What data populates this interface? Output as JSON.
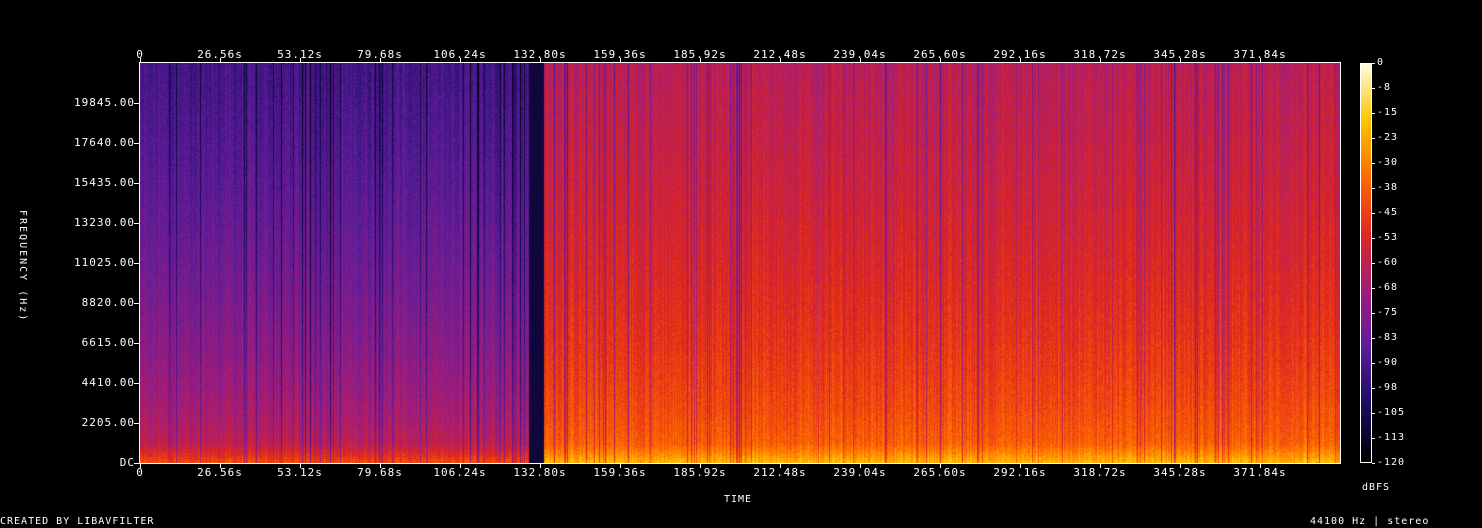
{
  "chart_data": {
    "type": "heatmap",
    "xlabel": "TIME",
    "ylabel": "FREQUENCY (Hz)",
    "x_ticks": [
      "0",
      "26.56s",
      "53.12s",
      "79.68s",
      "106.24s",
      "132.80s",
      "159.36s",
      "185.92s",
      "212.48s",
      "239.04s",
      "265.60s",
      "292.16s",
      "318.72s",
      "345.28s",
      "371.84s"
    ],
    "x_tick_values": [
      0,
      26.56,
      53.12,
      79.68,
      106.24,
      132.8,
      159.36,
      185.92,
      212.48,
      239.04,
      265.6,
      292.16,
      318.72,
      345.28,
      371.84
    ],
    "x_range": [
      0,
      398.4
    ],
    "y_ticks": [
      "DC",
      "2205.00",
      "4410.00",
      "6615.00",
      "8820.00",
      "11025.00",
      "13230.00",
      "15435.00",
      "17640.00",
      "19845.00"
    ],
    "y_tick_values": [
      0,
      2205,
      4410,
      6615,
      8820,
      11025,
      13230,
      15435,
      17640,
      19845
    ],
    "y_range": [
      0,
      22050
    ],
    "colorbar": {
      "label": "dBFS",
      "ticks": [
        "0",
        "-8",
        "-15",
        "-23",
        "-30",
        "-38",
        "-45",
        "-53",
        "-60",
        "-68",
        "-75",
        "-83",
        "-90",
        "-98",
        "-105",
        "-113",
        "-120"
      ],
      "range": [
        -120,
        0
      ],
      "colors": [
        "#000000",
        "#1a0b5e",
        "#5a1c9a",
        "#a01c7c",
        "#e0261e",
        "#ff6a00",
        "#ffc400",
        "#fffbe0"
      ]
    },
    "segments": [
      {
        "start": 0,
        "end": 131.5,
        "level_dB_low_freq": -50,
        "level_dB_high_freq": -92
      },
      {
        "start": 131.5,
        "end": 398.4,
        "level_dB_low_freq": -28,
        "level_dB_high_freq": -62
      }
    ]
  },
  "footer": {
    "left": "CREATED BY LIBAVFILTER",
    "right": "44100 Hz | stereo"
  }
}
